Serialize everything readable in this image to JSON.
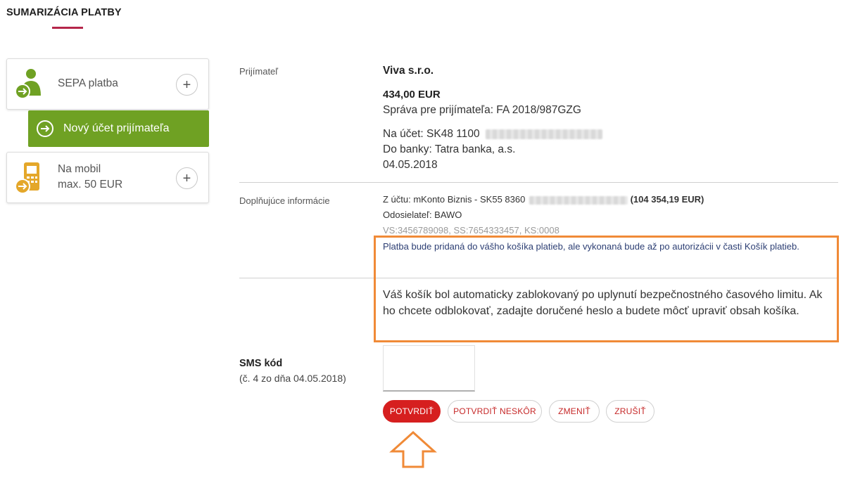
{
  "header": {
    "title": "SUMARIZÁCIA PLATBY"
  },
  "sidebar": {
    "sepa": {
      "label": "SEPA platba",
      "icon": "person-transfer-icon",
      "add_icon": "plus-icon"
    },
    "new_recipient": {
      "label": "Nový účet prijímateľa",
      "icon": "arrow-right-circle-icon"
    },
    "mobile": {
      "label_line1": "Na mobil",
      "label_line2": "max. 50 EUR",
      "icon": "phone-transfer-icon",
      "add_icon": "plus-icon"
    }
  },
  "recipient": {
    "label": "Prijímateľ",
    "name": "Viva s.r.o.",
    "amount": "434,00 EUR",
    "message": "Správa pre prijímateľa: FA 2018/987GZG",
    "account_prefix": "Na účet:  SK48 1100",
    "bank": "Do banky: Tatra banka, a.s.",
    "date": "04.05.2018"
  },
  "additional": {
    "label": "Doplňujúce informácie",
    "from_account_prefix": "Z účtu:  mKonto Biznis - SK55 8360",
    "from_account_balance": "(104 354,19 EUR)",
    "sender": "Odosielateľ:  BAWO",
    "symbols": "VS:3456789098, SS:7654333457, KS:0008",
    "basket_info": "Platba bude pridaná do vášho košíka platieb, ale vykonaná bude až po autorizácii v časti Košík platieb.",
    "lock_message": "Váš košík bol automaticky zablokovaný po uplynutí bezpečnostného časového limitu. Ak ho chcete odblokovať, zadajte doručené heslo a budete môcť upraviť obsah košíka."
  },
  "sms": {
    "label": "SMS kód",
    "sublabel": "(č. 4 zo dňa 04.05.2018)",
    "value": "",
    "placeholder": ""
  },
  "buttons": {
    "confirm": "POTVRDIŤ",
    "confirm_later": "POTVRDIŤ NESKÔR",
    "change": "ZMENIŤ",
    "cancel": "ZRUŠIŤ"
  },
  "colors": {
    "accent_red": "#d61f1f",
    "title_underline": "#b5264a",
    "green_button": "#6fa123",
    "highlight_orange": "#f08a37",
    "icon_green": "#6fa123",
    "icon_yellow": "#e4a72a"
  }
}
